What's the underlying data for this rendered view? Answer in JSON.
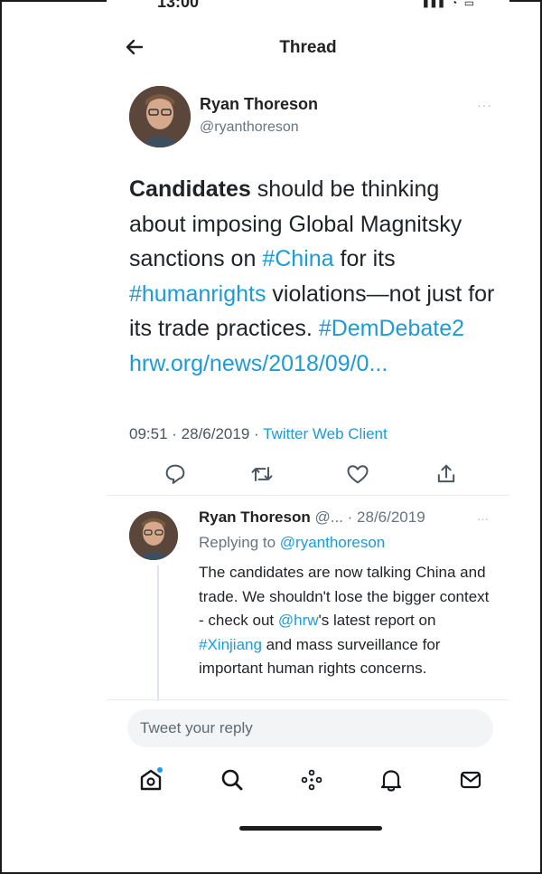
{
  "status": {
    "time": "13:00",
    "bars": "▮▮▮ ◔ ▭"
  },
  "header": {
    "title": "Thread"
  },
  "tweet": {
    "author_name": "Ryan Thoreson",
    "author_handle": "@ryanthoreson",
    "text_bold": "Candidates",
    "text_1": " should be thinking about imposing Global Magnitsky sanctions on ",
    "hashtag_china": "#China",
    "text_2": " for its ",
    "hashtag_humanrights": "#humanrights",
    "text_3": " violations—not just for its trade practices. ",
    "hashtag_demdebate": "#DemDebate2",
    "link_text": "hrw.org/news/2018/09/0...",
    "time": "09:51",
    "date": "28/6/2019",
    "client": "Twitter Web Client",
    "more": "···"
  },
  "reply": {
    "author_name": "Ryan Thoreson",
    "handle_truncated": "@...",
    "date": "· 28/6/2019",
    "more": "···",
    "replying_label": "Replying to ",
    "replying_handle": "@ryanthoreson",
    "text_1": "The candidates are now talking China and trade. We shouldn't lose the bigger context - check out ",
    "mention_hrw": "@hrw",
    "text_2": "'s latest report on ",
    "hashtag_xinjiang": "#Xinjiang",
    "text_3": " and mass surveillance for important human rights concerns."
  },
  "reply_box": {
    "placeholder": "Tweet your reply"
  },
  "nav": {
    "items": [
      "home-icon",
      "search-icon",
      "spaces-icon",
      "notifications-icon",
      "messages-icon"
    ]
  },
  "colors": {
    "link": "#1d9bd6",
    "text": "#1f2326",
    "muted": "#66757f"
  }
}
